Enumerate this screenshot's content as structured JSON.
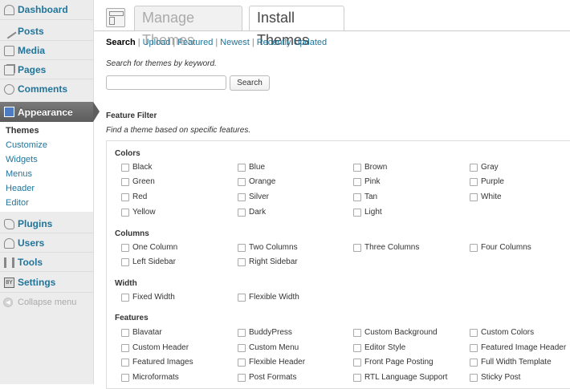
{
  "sidebar": {
    "items": [
      {
        "label": "Dashboard",
        "icon": "dashboard-icon"
      },
      {
        "label": "Posts",
        "icon": "posts-icon"
      },
      {
        "label": "Media",
        "icon": "media-icon"
      },
      {
        "label": "Pages",
        "icon": "pages-icon"
      },
      {
        "label": "Comments",
        "icon": "comments-icon"
      },
      {
        "label": "Appearance",
        "icon": "appearance-icon"
      },
      {
        "label": "Plugins",
        "icon": "plugins-icon"
      },
      {
        "label": "Users",
        "icon": "users-icon"
      },
      {
        "label": "Tools",
        "icon": "tools-icon"
      },
      {
        "label": "Settings",
        "icon": "settings-icon"
      }
    ],
    "submenu": [
      "Themes",
      "Customize",
      "Widgets",
      "Menus",
      "Header",
      "Editor"
    ],
    "collapse_label": "Collapse menu",
    "settings_icon_text": "8Y"
  },
  "tabs": [
    "Manage Themes",
    "Install Themes"
  ],
  "subnav": [
    "Search",
    "Upload",
    "Featured",
    "Newest",
    "Recently Updated"
  ],
  "search": {
    "description": "Search for themes by keyword.",
    "value": "",
    "button_label": "Search"
  },
  "filter": {
    "title": "Feature Filter",
    "description": "Find a theme based on specific features.",
    "groups": [
      {
        "title": "Colors",
        "options": [
          "Black",
          "Blue",
          "Brown",
          "Gray",
          "Green",
          "Orange",
          "Pink",
          "Purple",
          "Red",
          "Silver",
          "Tan",
          "White",
          "Yellow",
          "Dark",
          "Light"
        ]
      },
      {
        "title": "Columns",
        "options": [
          "One Column",
          "Two Columns",
          "Three Columns",
          "Four Columns",
          "Left Sidebar",
          "Right Sidebar"
        ]
      },
      {
        "title": "Width",
        "options": [
          "Fixed Width",
          "Flexible Width"
        ]
      },
      {
        "title": "Features",
        "options": [
          "Blavatar",
          "BuddyPress",
          "Custom Background",
          "Custom Colors",
          "Custom Header",
          "Custom Menu",
          "Editor Style",
          "Featured Image Header",
          "Featured Images",
          "Flexible Header",
          "Front Page Posting",
          "Full Width Template",
          "Microformats",
          "Post Formats",
          "RTL Language Support",
          "Sticky Post"
        ]
      }
    ]
  },
  "colors": {
    "link": "#21759b",
    "active_menu": "#5c5c5c"
  }
}
